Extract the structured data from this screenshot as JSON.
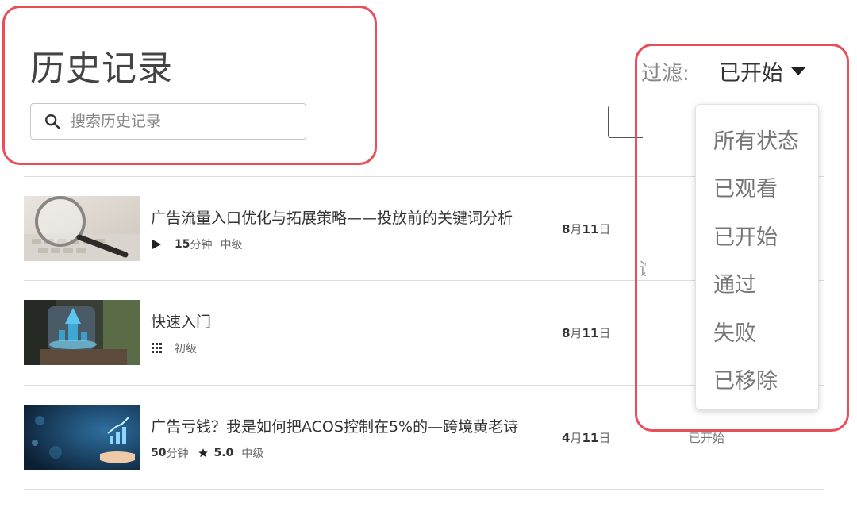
{
  "header": {
    "title": "历史记录",
    "search_placeholder": "搜索历史记录"
  },
  "filter": {
    "label": "过滤:",
    "selected": "已开始",
    "options": [
      "所有状态",
      "已观看",
      "已开始",
      "通过",
      "失败",
      "已移除"
    ]
  },
  "history": [
    {
      "title": "广告流量入口优化与拓展策略——投放前的关键词分析",
      "type_icon": "play-icon",
      "duration_num": "15",
      "duration_unit": "分钟",
      "level": "中级",
      "date_num": "8",
      "date_month": "月",
      "date_day": "11",
      "date_suffix": "日",
      "status": ""
    },
    {
      "title": "快速入门",
      "type_icon": "grid-icon",
      "level": "初级",
      "date_num": "8",
      "date_month": "月",
      "date_day": "11",
      "date_suffix": "日",
      "status": ""
    },
    {
      "title": "广告亏钱？我是如何把ACOS控制在5%的—跨境黄老诗",
      "duration_num": "50",
      "duration_unit": "分钟",
      "rating": "5.0",
      "level": "中级",
      "date_num": "4",
      "date_month": "月",
      "date_day": "11",
      "date_suffix": "日",
      "status": "已开始"
    }
  ],
  "partial_char": "谊",
  "colors": {
    "highlight": "#e94e5b",
    "text": "#333333",
    "muted": "#888888"
  }
}
